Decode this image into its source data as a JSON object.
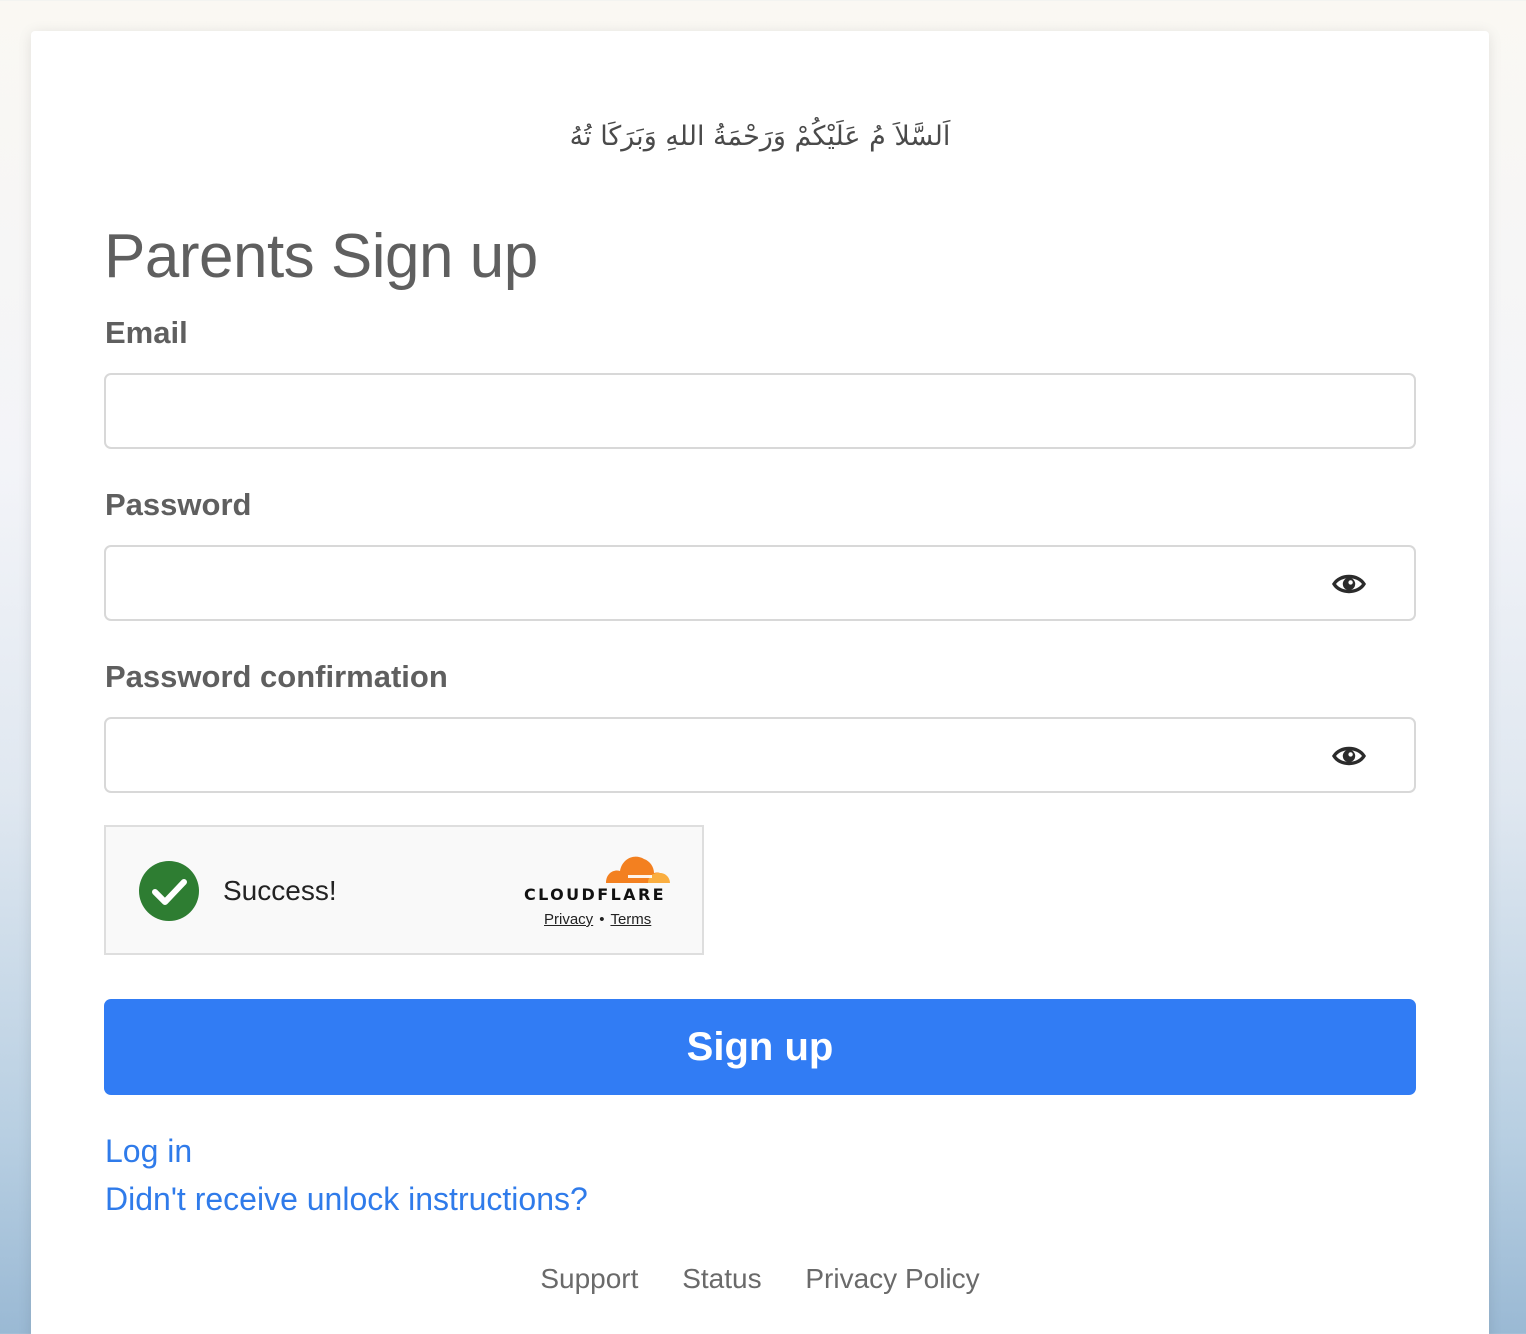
{
  "greeting": "اَلسَّلاَ مُ عَلَيْكُمْ وَرَحْمَةُ اللهِ وَبَرَكَا تُهُ",
  "page_title": "Parents Sign up",
  "form": {
    "email_label": "Email",
    "email_value": "",
    "password_label": "Password",
    "password_value": "",
    "password_confirmation_label": "Password confirmation",
    "password_confirmation_value": "",
    "show_password_icon": "eye-icon"
  },
  "captcha": {
    "status_text": "Success!",
    "status_icon": "checkmark-circle-icon",
    "status_color": "#2e7d32",
    "brand": "CLOUDFLARE",
    "brand_color": "#f38020",
    "privacy_label": "Privacy",
    "separator": "•",
    "terms_label": "Terms"
  },
  "submit_label": "Sign up",
  "submit_color": "#317cf4",
  "links": {
    "login": "Log in",
    "unlock": "Didn't receive unlock instructions?"
  },
  "footer": {
    "support": "Support",
    "status": "Status",
    "privacy_policy": "Privacy Policy"
  }
}
